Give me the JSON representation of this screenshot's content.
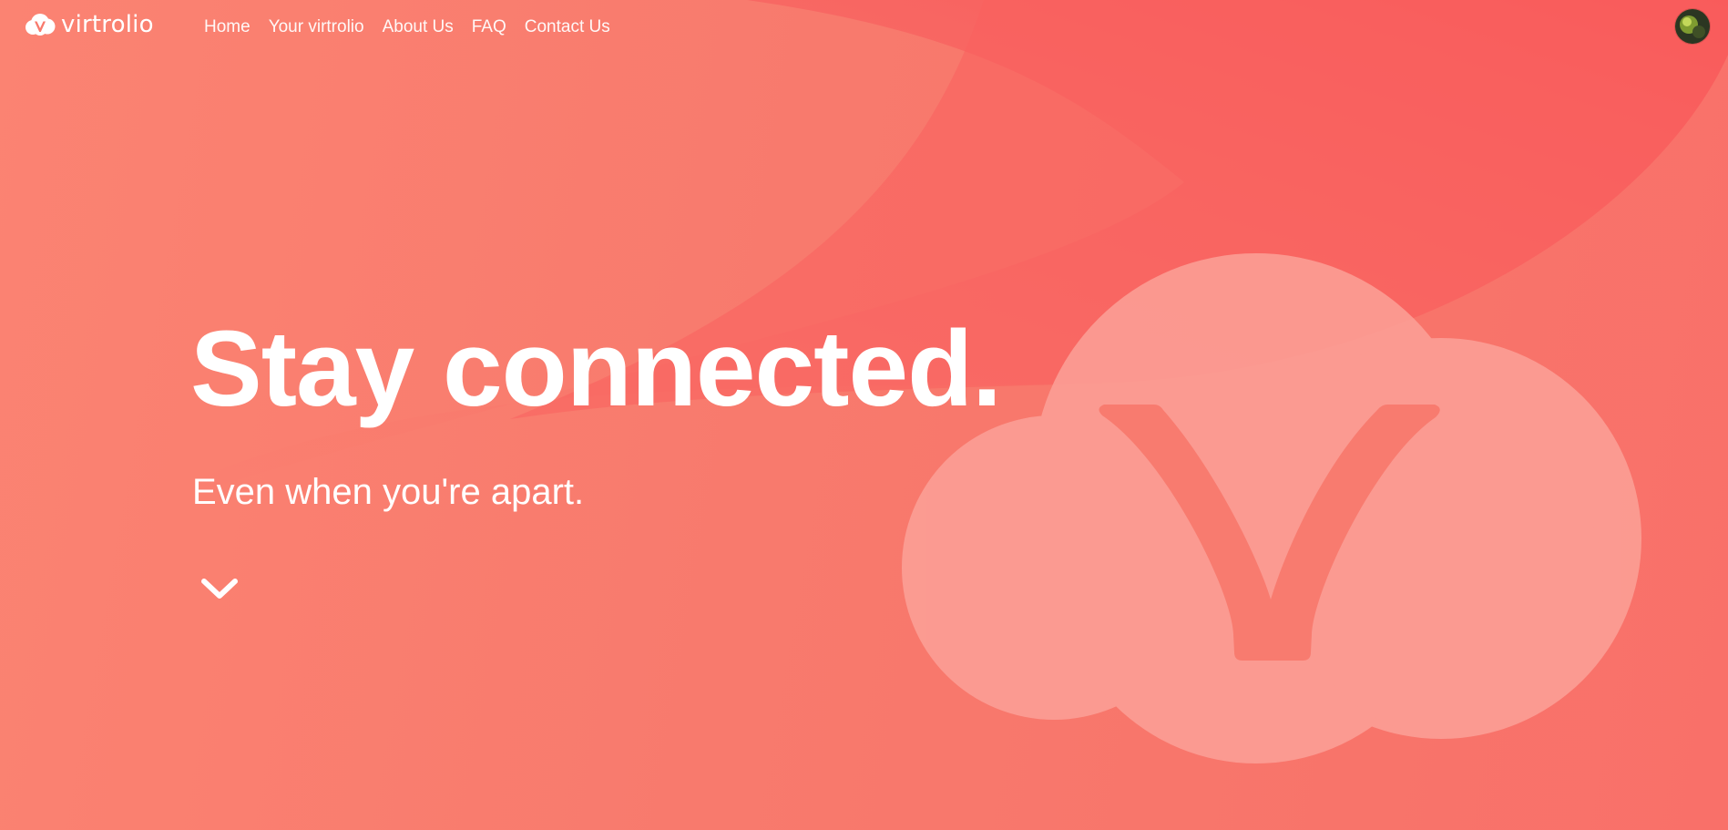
{
  "brand": {
    "name": "virtrolio",
    "logo_icon": "cloud-v-logo-icon"
  },
  "nav": {
    "items": [
      {
        "label": "Home"
      },
      {
        "label": "Your virtrolio"
      },
      {
        "label": "About Us"
      },
      {
        "label": "FAQ"
      },
      {
        "label": "Contact Us"
      }
    ]
  },
  "user": {
    "avatar_icon": "user-avatar"
  },
  "hero": {
    "title": "Stay connected.",
    "subtitle": "Even when you're apart.",
    "scroll_icon": "chevron-down-icon",
    "illustration_icon": "cloud-v-illustration"
  },
  "colors": {
    "background_start": "#fb8372",
    "background_end": "#f97069",
    "swoosh": "#f95a5c",
    "cloud_fill": "#fc9d93",
    "cloud_v": "#f87a6d",
    "text": "#ffffff"
  }
}
